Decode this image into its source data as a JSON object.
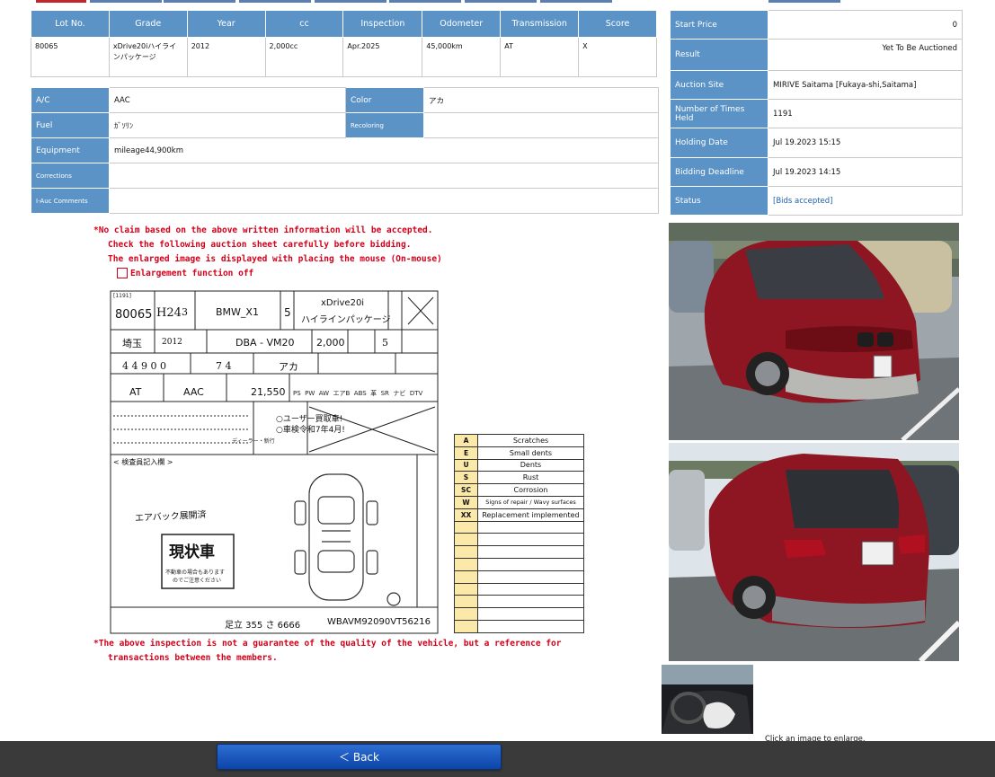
{
  "summary": {
    "headers": [
      "Lot No.",
      "Grade",
      "Year",
      "cc",
      "Inspection",
      "Odometer",
      "Transmission",
      "Score"
    ],
    "row": [
      "80065",
      "xDrive20iハイラインパッケージ",
      "2012",
      "2,000cc",
      "Apr.2025",
      "45,000km",
      "AT",
      "X"
    ]
  },
  "detail": {
    "ac_label": "A/C",
    "ac_value": "AAC",
    "color_label": "Color",
    "color_value": "アカ",
    "fuel_label": "Fuel",
    "fuel_value": "ｶﾞｿﾘﾝ",
    "recoloring_label": "Recoloring",
    "recoloring_value": "",
    "equipment_label": "Equipment",
    "equipment_value": "mileage44,900km",
    "corrections_label": "Corrections",
    "corrections_value": "",
    "comments_label": "I-Auc Comments",
    "comments_value": ""
  },
  "info": {
    "start_price_label": "Start Price",
    "start_price_value": "0",
    "result_label": "Result",
    "result_value": "Yet To Be Auctioned",
    "site_label": "Auction Site",
    "site_value": "MIRIVE Saitama [Fukaya-shi,Saitama]",
    "times_label": "Number of Times Held",
    "times_value": "1191",
    "holding_label": "Holding Date",
    "holding_value": "Jul 19.2023 15:15",
    "deadline_label": "Bidding Deadline",
    "deadline_value": "Jul 19.2023 14:15",
    "status_label": "Status",
    "status_value": "[Bids accepted]"
  },
  "notices": {
    "line1": "*No claim based on the above written information will be accepted.",
    "line2": "Check the following auction sheet carefully before bidding.",
    "line3": "The enlarged image is displayed with placing the mouse (On-mouse)",
    "enlarge_label": "Enlargement function off",
    "bottom1": "*The above inspection is not a guarantee of the quality of the vehicle, but a reference for",
    "bottom2": "transactions between the members."
  },
  "sheet": {
    "times": "[1191]",
    "lot": "80065",
    "era_year": "H24",
    "month": "3",
    "maker_model": "BMW_X1",
    "doors": "5",
    "grade_line1": "xDrive20i",
    "grade_line2": "ハイラインパッケージ",
    "region": "埼玉",
    "year": "2012",
    "model_code": "DBA - VM20",
    "cc": "2,000",
    "seats": "5",
    "mileage": "4 4 9 0 0",
    "inspection": "7  4",
    "color": "アカ",
    "shift": "AT",
    "aircon": "AAC",
    "recycle": "21,550",
    "options": [
      "PS",
      "PW",
      "AW",
      "エアB",
      "ABS",
      "革",
      "SR",
      "ナビ",
      "DTV"
    ],
    "sales_point1": "○ユーザー買取車!",
    "sales_point2": "○車検令和7年4月!",
    "dealer": "ディーラー・新行",
    "inspector_note": "< 検査員記入欄 >",
    "handwritten": "エアバック展開済",
    "condition_stamp": "現状車",
    "stamp_sub1": "不動車の場合もあります",
    "stamp_sub2": "のでご注意ください",
    "plate": "足立 355 さ 6666",
    "vin": "WBAVM92090VT56216",
    "score": "X"
  },
  "legend": [
    {
      "code": "A",
      "label": "Scratches"
    },
    {
      "code": "E",
      "label": "Small dents"
    },
    {
      "code": "U",
      "label": "Dents"
    },
    {
      "code": "S",
      "label": "Rust"
    },
    {
      "code": "SC",
      "label": "Corrosion"
    },
    {
      "code": "W",
      "label": "Signs of repair / Wavy surfaces"
    },
    {
      "code": "XX",
      "label": "Replacement implemented"
    }
  ],
  "caption": "Click an image to enlarge.",
  "back_label": "＜ Back",
  "colors": {
    "header_blue": "#5b93c7",
    "notice_red": "#d4001a",
    "car_red": "#8e1622",
    "button_blue": "#1d5bc2"
  }
}
